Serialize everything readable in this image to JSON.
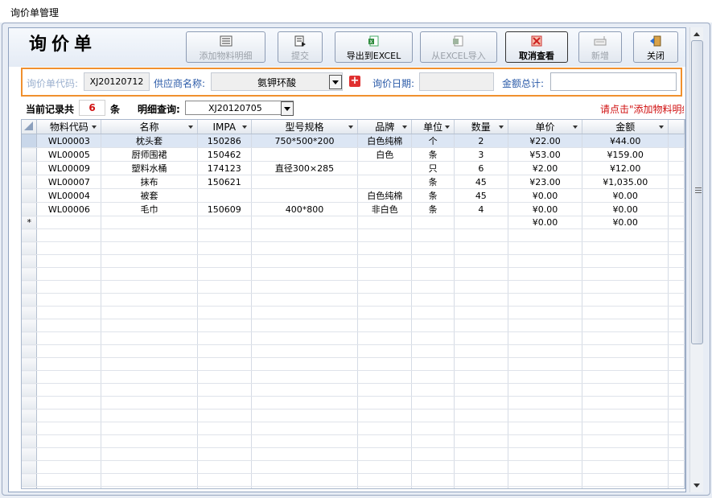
{
  "window": {
    "title": "询价单管理"
  },
  "form_title": "询价单",
  "toolbar": [
    {
      "name": "add-material-detail-button",
      "label": "添加物料明细",
      "icon": "list-icon",
      "enabled": false
    },
    {
      "name": "submit-button",
      "label": "提交",
      "icon": "submit-icon",
      "enabled": false
    },
    {
      "name": "export-excel-button",
      "label": "导出到EXCEL",
      "icon": "excel-export-icon",
      "enabled": true
    },
    {
      "name": "import-excel-button",
      "label": "从EXCEL导入",
      "icon": "excel-import-icon",
      "enabled": false
    },
    {
      "name": "cancel-view-button",
      "label": "取消查看",
      "icon": "cancel-icon",
      "enabled": true,
      "active": true
    },
    {
      "name": "new-button",
      "label": "新增",
      "icon": "keyboard-icon",
      "enabled": false
    },
    {
      "name": "close-button",
      "label": "关闭",
      "icon": "exit-door-icon",
      "enabled": true
    }
  ],
  "form": {
    "inquiry_code_label": "询价单代码:",
    "inquiry_code_value": "XJ20120712",
    "supplier_label": "供应商名称:",
    "supplier_value": "氨钾环酸",
    "inquiry_date_label": "询价日期:",
    "inquiry_date_value": "",
    "amount_total_label": "金额总计:",
    "amount_total_value": ""
  },
  "records": {
    "prefix": "当前记录共",
    "count": "6",
    "suffix": "条",
    "detail_label": "明细查询:",
    "detail_value": "XJ20120705",
    "hint": "请点击\"添加物料明细\""
  },
  "grid": {
    "columns": [
      "物料代码",
      "名称",
      "IMPA",
      "型号规格",
      "品牌",
      "单位",
      "数量",
      "单价",
      "金额"
    ],
    "rows": [
      [
        "WL00003",
        "枕头套",
        "150286",
        "750*500*200",
        "白色纯棉",
        "个",
        "2",
        "¥22.00",
        "¥44.00"
      ],
      [
        "WL00005",
        "厨师围裙",
        "150462",
        "",
        "白色",
        "条",
        "3",
        "¥53.00",
        "¥159.00"
      ],
      [
        "WL00009",
        "塑料水桶",
        "174123",
        "直径300×285",
        "",
        "只",
        "6",
        "¥2.00",
        "¥12.00"
      ],
      [
        "WL00007",
        "抹布",
        "150621",
        "",
        "",
        "条",
        "45",
        "¥23.00",
        "¥1,035.00"
      ],
      [
        "WL00004",
        "被套",
        "",
        "",
        "白色纯棉",
        "条",
        "45",
        "¥0.00",
        "¥0.00"
      ],
      [
        "WL00006",
        "毛巾",
        "150609",
        "400*800",
        "非白色",
        "条",
        "4",
        "¥0.00",
        "¥0.00"
      ]
    ],
    "new_row_marker": "*",
    "new_row": [
      "",
      "",
      "",
      "",
      "",
      "",
      "",
      "¥0.00",
      "¥0.00"
    ]
  }
}
